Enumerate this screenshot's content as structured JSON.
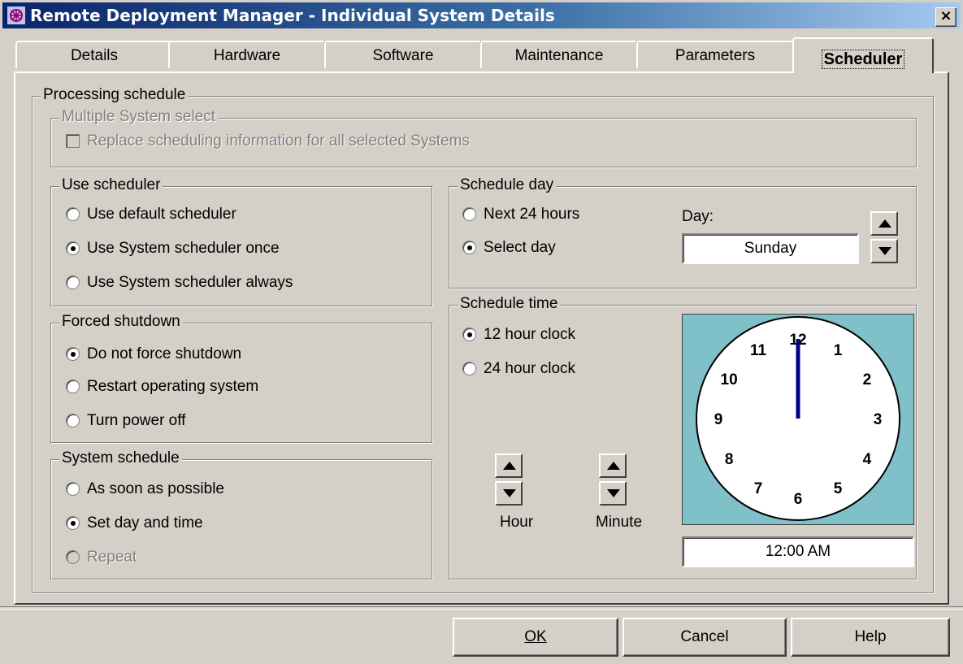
{
  "window": {
    "title": "Remote Deployment Manager - Individual System Details",
    "close_glyph": "×"
  },
  "tabs": [
    {
      "label": "Details"
    },
    {
      "label": "Hardware"
    },
    {
      "label": "Software"
    },
    {
      "label": "Maintenance"
    },
    {
      "label": "Parameters"
    },
    {
      "label": "Scheduler",
      "active": true
    }
  ],
  "processing": {
    "label": "Processing schedule",
    "multi": {
      "label": "Multiple System select",
      "checkbox_label": "Replace scheduling information for all selected Systems",
      "checked": false,
      "enabled": false
    }
  },
  "use_scheduler": {
    "label": "Use scheduler",
    "options": [
      "Use default scheduler",
      "Use System scheduler once",
      "Use System scheduler always"
    ],
    "selected": 1
  },
  "forced_shutdown": {
    "label": "Forced shutdown",
    "options": [
      "Do not force shutdown",
      "Restart operating system",
      "Turn power off"
    ],
    "selected": 0
  },
  "system_schedule": {
    "label": "System schedule",
    "options": [
      "As soon as possible",
      "Set day and time",
      "Repeat"
    ],
    "selected": 1,
    "disabled": [
      2
    ]
  },
  "schedule_day": {
    "label": "Schedule day",
    "options": [
      "Next 24 hours",
      "Select day"
    ],
    "selected": 1,
    "day_label": "Day:",
    "day_value": "Sunday"
  },
  "schedule_time": {
    "label": "Schedule time",
    "options": [
      "12 hour clock",
      "24 hour clock"
    ],
    "selected": 0,
    "hour_label": "Hour",
    "minute_label": "Minute",
    "time_value": "12:00 AM",
    "clock_numbers": [
      "12",
      "1",
      "2",
      "3",
      "4",
      "5",
      "6",
      "7",
      "8",
      "9",
      "10",
      "11"
    ],
    "clock_hour": 12,
    "clock_minute": 0,
    "colors": {
      "clock_bg": "#80c0c8",
      "hand": "#000080"
    }
  },
  "buttons": {
    "ok": "OK",
    "cancel": "Cancel",
    "help": "Help"
  }
}
